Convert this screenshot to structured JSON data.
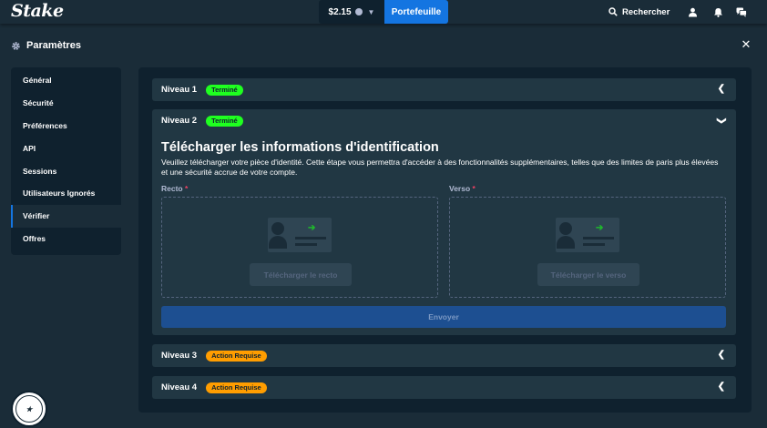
{
  "header": {
    "logo": "Stake",
    "balance": "$2.15",
    "wallet_label": "Portefeuille",
    "search_label": "Rechercher"
  },
  "settings": {
    "title": "Paramètres"
  },
  "sidebar": {
    "items": [
      {
        "label": "Général"
      },
      {
        "label": "Sécurité"
      },
      {
        "label": "Préférences"
      },
      {
        "label": "API"
      },
      {
        "label": "Sessions"
      },
      {
        "label": "Utilisateurs Ignorés"
      },
      {
        "label": "Vérifier"
      },
      {
        "label": "Offres"
      }
    ],
    "active": "Vérifier"
  },
  "levels": [
    {
      "title": "Niveau 1",
      "status": "Terminé"
    },
    {
      "title": "Niveau 2",
      "status": "Terminé"
    },
    {
      "title": "Niveau 3",
      "status": "Action Requise"
    },
    {
      "title": "Niveau 4",
      "status": "Action Requise"
    }
  ],
  "upload": {
    "title": "Télécharger les informations d'identification",
    "description": "Veuillez télécharger votre pièce d'identité. Cette étape vous permettra d'accéder à des fonctionnalités supplémentaires, telles que des limites de paris plus élevées et une sécurité accrue de votre compte.",
    "front_label": "Recto",
    "back_label": "Verso",
    "required_mark": "*",
    "front_button": "Télécharger le recto",
    "back_button": "Télécharger le verso",
    "submit_label": "Envoyer"
  },
  "colors": {
    "background": "#1a2c38",
    "panel": "#0f212e",
    "accent": "#1475e1",
    "done": "#1fff20",
    "action": "#ff9d00"
  }
}
